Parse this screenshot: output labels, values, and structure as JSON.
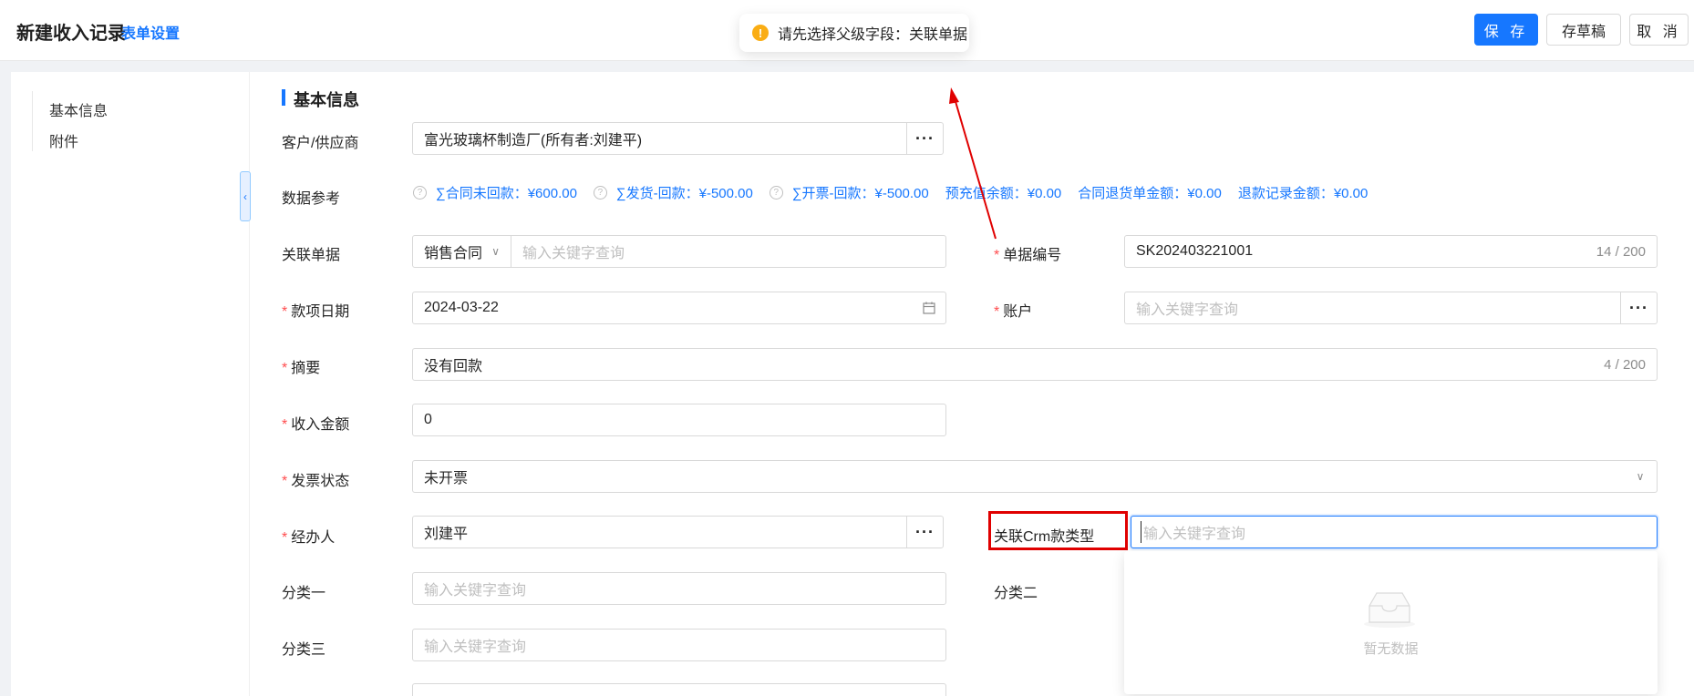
{
  "header": {
    "title": "新建收入记录",
    "form_settings": "表单设置",
    "save": "保 存",
    "draft": "存草稿",
    "cancel": "取 消"
  },
  "toast": {
    "message": "请先选择父级字段：关联单据"
  },
  "sidenav": {
    "items": [
      "基本信息",
      "附件"
    ]
  },
  "section": {
    "title": "基本信息"
  },
  "form": {
    "customer": {
      "label": "客户/供应商",
      "value": "富光玻璃杯制造厂(所有者:刘建平)"
    },
    "data_ref": {
      "label": "数据参考",
      "items": [
        "∑合同未回款：¥600.00",
        "∑发货-回款：¥-500.00",
        "∑开票-回款：¥-500.00",
        "预充值余额：¥0.00",
        "合同退货单金额：¥0.00",
        "退款记录金额：¥0.00"
      ]
    },
    "related_doc": {
      "label": "关联单据",
      "type": "销售合同",
      "placeholder": "输入关键字查询"
    },
    "doc_no": {
      "label": "单据编号",
      "value": "SK202403221001",
      "count": "14 / 200"
    },
    "date": {
      "label": "款项日期",
      "value": "2024-03-22"
    },
    "account": {
      "label": "账户",
      "placeholder": "输入关键字查询"
    },
    "summary": {
      "label": "摘要",
      "value": "没有回款",
      "count": "4 / 200"
    },
    "amount": {
      "label": "收入金额",
      "value": "0"
    },
    "invoice_status": {
      "label": "发票状态",
      "value": "未开票"
    },
    "handler": {
      "label": "经办人",
      "value": "刘建平"
    },
    "crm_type": {
      "label": "关联Crm款类型",
      "placeholder": "输入关键字查询"
    },
    "cat1": {
      "label": "分类一",
      "placeholder": "输入关键字查询"
    },
    "cat2": {
      "label": "分类二"
    },
    "cat3": {
      "label": "分类三",
      "placeholder": "输入关键字查询"
    },
    "dropdown_empty": "暂无数据"
  },
  "icons": {
    "warning": "warning-icon",
    "help": "question-circle-icon",
    "calendar": "calendar-icon",
    "chevron": "chevron-down-icon",
    "more": "ellipsis-icon",
    "empty": "inbox-icon"
  },
  "colors": {
    "primary": "#1677ff",
    "required": "#ff4d4f",
    "warning": "#faad14",
    "annotation": "#e00000"
  }
}
